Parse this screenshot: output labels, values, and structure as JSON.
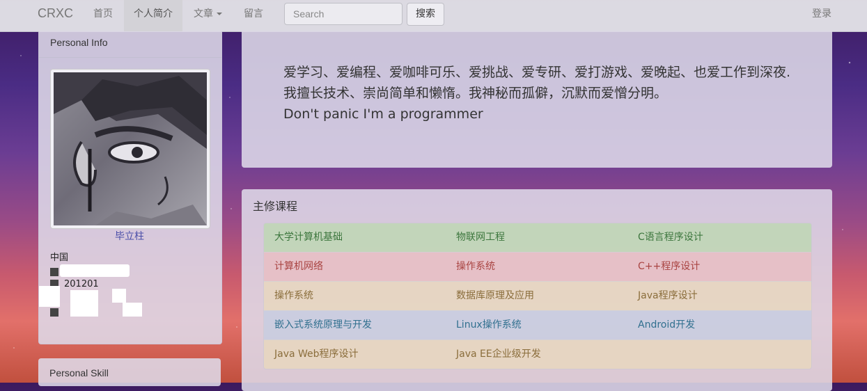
{
  "navbar": {
    "brand": "CRXC",
    "items": [
      {
        "label": "首页"
      },
      {
        "label": "个人简介"
      },
      {
        "label": "文章"
      },
      {
        "label": "留言"
      }
    ],
    "search_placeholder": "Search",
    "search_button": "搜索",
    "login": "登录"
  },
  "personal_info": {
    "heading": "Personal Info",
    "name": "毕立柱",
    "country": "中国",
    "date": "201201"
  },
  "intro": {
    "text": "爱学习、爱编程、爱咖啡可乐、爱挑战、爱专研、爱打游戏、爱晚起、也爱工作到深夜.我擅长技术、崇尚简单和懒惰。我神秘而孤僻，沉默而爱憎分明。",
    "motto": "Don't panic I'm a programmer"
  },
  "courses": {
    "title": "主修课程",
    "rows": [
      {
        "style": "success",
        "cells": [
          "大学计算机基础",
          "物联网工程",
          "C语言程序设计"
        ]
      },
      {
        "style": "danger",
        "cells": [
          "计算机网络",
          "操作系统",
          "C++程序设计"
        ]
      },
      {
        "style": "warning",
        "cells": [
          "操作系统",
          "数据库原理及应用",
          "Java程序设计"
        ]
      },
      {
        "style": "info",
        "cells": [
          "嵌入式系统原理与开发",
          "Linux操作系统",
          "Android开发"
        ]
      },
      {
        "style": "warning",
        "cells": [
          "Java Web程序设计",
          "Java EE企业级开发",
          ""
        ]
      }
    ]
  },
  "personal_skill": {
    "heading": "Personal Skill"
  }
}
